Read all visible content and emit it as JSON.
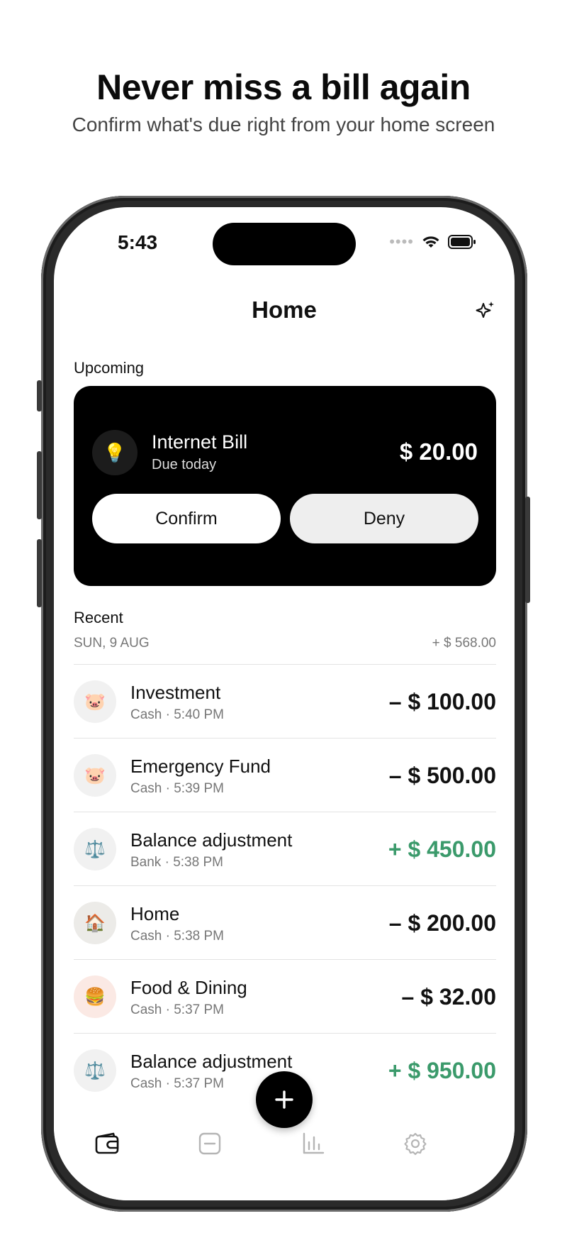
{
  "promo": {
    "headline": "Never miss a bill again",
    "subline": "Confirm what's due right from your home screen"
  },
  "status_bar": {
    "time": "5:43"
  },
  "header": {
    "title": "Home",
    "action_icon": "sparkles-icon"
  },
  "upcoming": {
    "section_label": "Upcoming",
    "bill": {
      "icon": "lightbulb",
      "title": "Internet Bill",
      "subtitle": "Due today",
      "amount": "$ 20.00"
    },
    "confirm_label": "Confirm",
    "deny_label": "Deny"
  },
  "recent": {
    "section_label": "Recent",
    "date": "SUN, 9 AUG",
    "date_total": "+ $ 568.00",
    "transactions": [
      {
        "icon": "pig",
        "title": "Investment",
        "subtitle": "Cash · 5:40 PM",
        "amount": "– $ 100.00",
        "type": "expense"
      },
      {
        "icon": "pig",
        "title": "Emergency Fund",
        "subtitle": "Cash · 5:39 PM",
        "amount": "– $ 500.00",
        "type": "expense"
      },
      {
        "icon": "balance-scale",
        "title": "Balance adjustment",
        "subtitle": "Bank · 5:38 PM",
        "amount": "+ $ 450.00",
        "type": "income"
      },
      {
        "icon": "house",
        "title": "Home",
        "subtitle": "Cash · 5:38 PM",
        "amount": "– $ 200.00",
        "type": "expense"
      },
      {
        "icon": "burger",
        "title": "Food & Dining",
        "subtitle": "Cash · 5:37 PM",
        "amount": "– $ 32.00",
        "type": "expense"
      },
      {
        "icon": "balance-scale",
        "title": "Balance adjustment",
        "subtitle": "Cash · 5:37 PM",
        "amount": "+ $ 950.00",
        "type": "income"
      }
    ]
  },
  "tab_bar": {
    "items": [
      "wallet-icon",
      "budget-icon",
      "stats-icon",
      "settings-icon"
    ],
    "active": "wallet-icon",
    "fab_icon": "plus-icon"
  },
  "colors": {
    "income": "#3b9a6b",
    "card_background": "#000000",
    "deny_button": "#eeeeee"
  }
}
